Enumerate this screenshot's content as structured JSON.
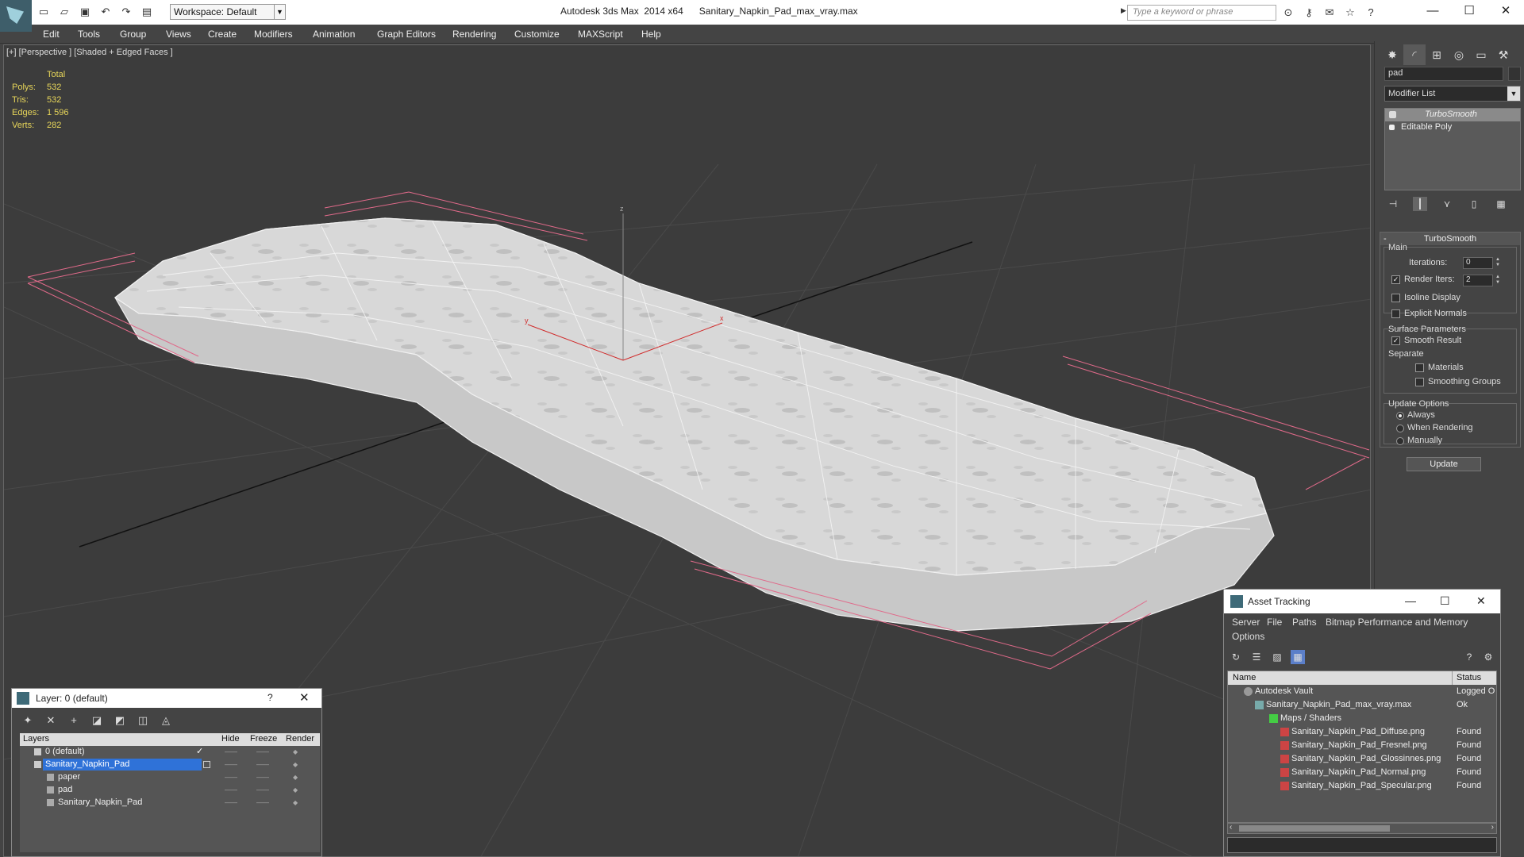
{
  "titlebar": {
    "workspace": "Workspace: Default",
    "app_title": "Autodesk 3ds Max  2014 x64      Sanitary_Napkin_Pad_max_vray.max",
    "search_placeholder": "Type a keyword or phrase"
  },
  "menu": [
    "Edit",
    "Tools",
    "Group",
    "Views",
    "Create",
    "Modifiers",
    "Animation",
    "Graph Editors",
    "Rendering",
    "Customize",
    "MAXScript",
    "Help"
  ],
  "viewport": {
    "label": "[+] [Perspective ] [Shaded + Edged Faces ]",
    "stats": {
      "header": "Total",
      "rows": [
        {
          "key": "Polys:",
          "value": "532"
        },
        {
          "key": "Tris:",
          "value": "532"
        },
        {
          "key": "Edges:",
          "value": "1 596"
        },
        {
          "key": "Verts:",
          "value": "282"
        }
      ]
    },
    "axis_labels": {
      "x": "x",
      "y": "y",
      "z": "z"
    }
  },
  "command_panel": {
    "object_name": "pad",
    "modifier_list": "Modifier List",
    "stack": [
      "TurboSmooth",
      "Editable Poly"
    ],
    "turbosmooth": {
      "title": "TurboSmooth",
      "main_label": "Main",
      "iterations_label": "Iterations:",
      "iterations_value": "0",
      "render_iters_label": "Render Iters:",
      "render_iters_value": "2",
      "isoline_label": "Isoline Display",
      "explicit_label": "Explicit Normals",
      "surface_label": "Surface Parameters",
      "smooth_result_label": "Smooth Result",
      "separate_label": "Separate",
      "materials_label": "Materials",
      "smoothing_groups_label": "Smoothing Groups",
      "update_options_label": "Update Options",
      "always_label": "Always",
      "when_rendering_label": "When Rendering",
      "manually_label": "Manually",
      "update_button": "Update"
    }
  },
  "layer_dialog": {
    "title": "Layer: 0 (default)",
    "help": "?",
    "columns": {
      "layers": "Layers",
      "hide": "Hide",
      "freeze": "Freeze",
      "render": "Render"
    },
    "rows": [
      {
        "name": "0 (default)",
        "indent": 0,
        "selected": false,
        "check": true
      },
      {
        "name": "Sanitary_Napkin_Pad",
        "indent": 0,
        "selected": true,
        "check": false
      },
      {
        "name": "paper",
        "indent": 1,
        "selected": false,
        "check": false
      },
      {
        "name": "pad",
        "indent": 1,
        "selected": false,
        "check": false
      },
      {
        "name": "Sanitary_Napkin_Pad",
        "indent": 1,
        "selected": false,
        "check": false
      }
    ]
  },
  "asset_dialog": {
    "title": "Asset Tracking",
    "menu": [
      "Server",
      "File",
      "Paths",
      "Bitmap Performance and Memory",
      "Options"
    ],
    "columns": {
      "name": "Name",
      "status": "Status"
    },
    "rows": [
      {
        "name": "Autodesk Vault",
        "status": "Logged O",
        "indent": 0,
        "icon": "vault-icon"
      },
      {
        "name": "Sanitary_Napkin_Pad_max_vray.max",
        "status": "Ok",
        "indent": 1,
        "icon": "max-file-icon"
      },
      {
        "name": "Maps / Shaders",
        "status": "",
        "indent": 2,
        "icon": "maps-icon"
      },
      {
        "name": "Sanitary_Napkin_Pad_Diffuse.png",
        "status": "Found",
        "indent": 3,
        "icon": "png-icon"
      },
      {
        "name": "Sanitary_Napkin_Pad_Fresnel.png",
        "status": "Found",
        "indent": 3,
        "icon": "png-icon"
      },
      {
        "name": "Sanitary_Napkin_Pad_Glossinnes.png",
        "status": "Found",
        "indent": 3,
        "icon": "png-icon"
      },
      {
        "name": "Sanitary_Napkin_Pad_Normal.png",
        "status": "Found",
        "indent": 3,
        "icon": "png-icon"
      },
      {
        "name": "Sanitary_Napkin_Pad_Specular.png",
        "status": "Found",
        "indent": 3,
        "icon": "png-icon"
      }
    ]
  },
  "colors": {
    "selection": "#2f72d8",
    "stats_text": "#e8d65a",
    "bbox": "#e06a8a"
  }
}
